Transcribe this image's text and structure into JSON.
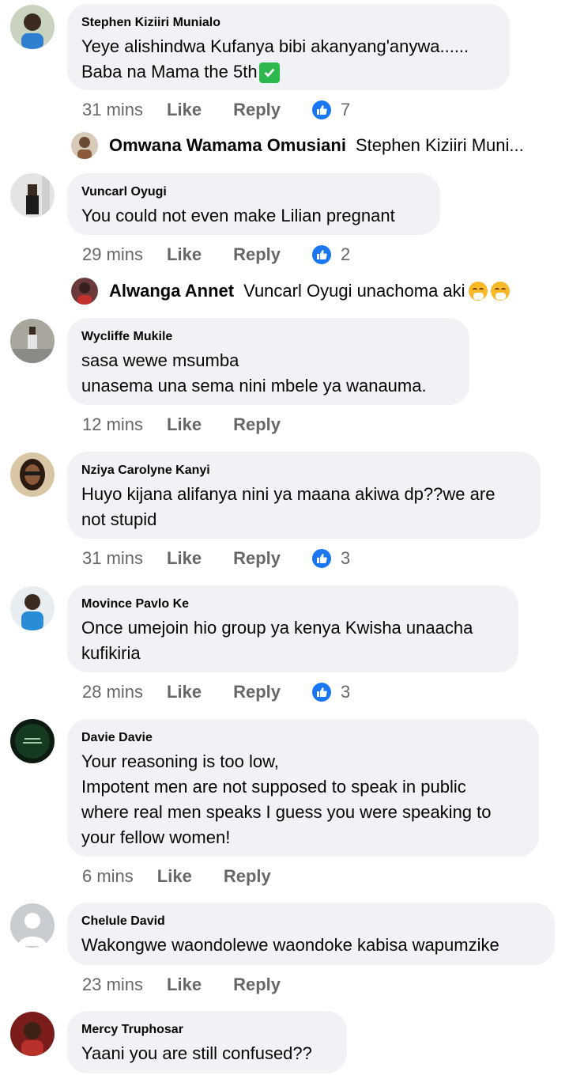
{
  "colors": {
    "bubble": "#f0f2f5",
    "meta_text": "#65676b",
    "like_blue": "#1877f2"
  },
  "actions": {
    "like": "Like",
    "reply": "Reply"
  },
  "comments": [
    {
      "author": "Stephen Kiziiri Munialo",
      "text": "Yeye alishindwa Kufanya bibi akanyang'anywa......\nBaba na Mama the 5th",
      "emoji": "white-heavy-check-mark-icon",
      "time": "31 mins",
      "like_count": "7",
      "reply_preview": {
        "name": "Omwana Wamama Omusiani",
        "text": "Stephen Kiziiri Muni..."
      }
    },
    {
      "author": "Vuncarl Oyugi",
      "text": "You could not even make Lilian pregnant",
      "time": "29 mins",
      "like_count": "2",
      "reply_preview": {
        "name": "Alwanga Annet",
        "text": "Vuncarl Oyugi unachoma aki"
      }
    },
    {
      "author": "Wycliffe Mukile",
      "text": "sasa wewe msumba\nunasema una sema nini mbele ya wanauma.",
      "time": "12 mins"
    },
    {
      "author": "Nziya Carolyne Kanyi",
      "text": "Huyo kijana alifanya nini ya maana akiwa dp??we are\nnot stupid",
      "time": "31 mins",
      "like_count": "3"
    },
    {
      "author": "Movince Pavlo Ke",
      "text": "Once umejoin hio group ya kenya Kwisha unaacha\nkufikiria",
      "time": "28 mins",
      "like_count": "3"
    },
    {
      "author": "Davie Davie",
      "text": "Your reasoning is too low,\nImpotent men are not supposed to speak in public\nwhere real men speaks I guess you were speaking to\nyour fellow women!",
      "time": "6 mins"
    },
    {
      "author": "Chelule David",
      "text": "Wakongwe waondolewe waondoke kabisa wapumzike",
      "time": "23 mins"
    },
    {
      "author": "Mercy Truphosar",
      "text": "Yaani you are still confused??"
    }
  ]
}
